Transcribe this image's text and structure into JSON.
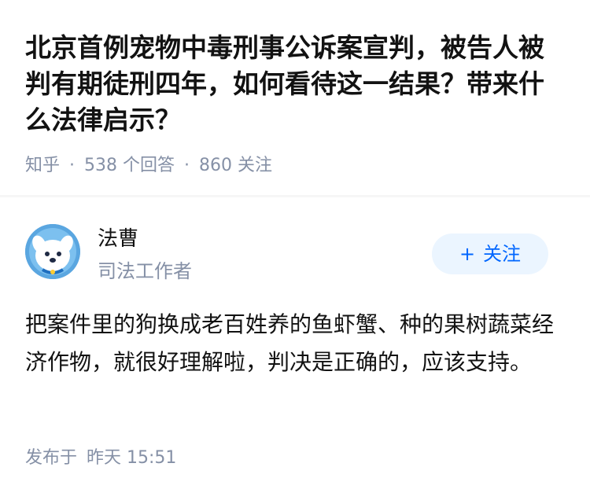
{
  "question": {
    "title": "北京首例宠物中毒刑事公诉案宣判，被告人被判有期徒刑四年，如何看待这一结果？带来什么法律启示？",
    "source": "知乎",
    "answer_count": "538 个回答",
    "follower_count": "860 关注",
    "separator": "·"
  },
  "answer": {
    "author": {
      "name": "法曹",
      "headline": "司法工作者",
      "avatar_icon": "dog-mascot-avatar"
    },
    "follow_button": {
      "plus": "+",
      "label": "关注"
    },
    "content": "把案件里的狗换成老百姓养的鱼虾蟹、种的果树蔬菜经济作物，就很好理解啦，判决是正确的，应该支持。",
    "published_prefix": "发布于",
    "published_time": "昨天 15:51"
  },
  "colors": {
    "accent": "#0066ff",
    "follow_bg": "#ebf5ff",
    "meta_gray": "#8590a6",
    "text": "#121212",
    "avatar_bg": "#5aa6e0"
  }
}
